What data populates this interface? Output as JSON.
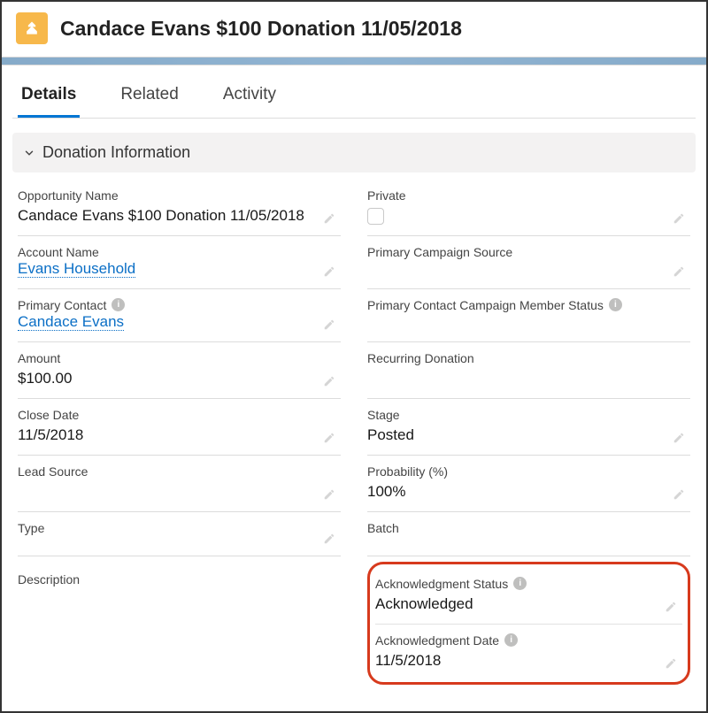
{
  "header": {
    "title": "Candace Evans $100 Donation 11/05/2018"
  },
  "tabs": [
    {
      "label": "Details",
      "active": true
    },
    {
      "label": "Related",
      "active": false
    },
    {
      "label": "Activity",
      "active": false
    }
  ],
  "section": {
    "title": "Donation Information"
  },
  "fields": {
    "opportunity_name": {
      "label": "Opportunity Name",
      "value": "Candace Evans $100 Donation 11/05/2018"
    },
    "private": {
      "label": "Private",
      "checked": false
    },
    "account_name": {
      "label": "Account Name",
      "value": "Evans Household"
    },
    "primary_campaign_source": {
      "label": "Primary Campaign Source",
      "value": ""
    },
    "primary_contact": {
      "label": "Primary Contact",
      "value": "Candace Evans"
    },
    "primary_contact_cms": {
      "label": "Primary Contact Campaign Member Status",
      "value": ""
    },
    "amount": {
      "label": "Amount",
      "value": "$100.00"
    },
    "recurring_donation": {
      "label": "Recurring Donation",
      "value": ""
    },
    "close_date": {
      "label": "Close Date",
      "value": "11/5/2018"
    },
    "stage": {
      "label": "Stage",
      "value": "Posted"
    },
    "lead_source": {
      "label": "Lead Source",
      "value": ""
    },
    "probability": {
      "label": "Probability (%)",
      "value": "100%"
    },
    "type": {
      "label": "Type",
      "value": ""
    },
    "batch": {
      "label": "Batch",
      "value": ""
    },
    "description": {
      "label": "Description",
      "value": ""
    },
    "ack_status": {
      "label": "Acknowledgment Status",
      "value": "Acknowledged"
    },
    "ack_date": {
      "label": "Acknowledgment Date",
      "value": "11/5/2018"
    }
  }
}
